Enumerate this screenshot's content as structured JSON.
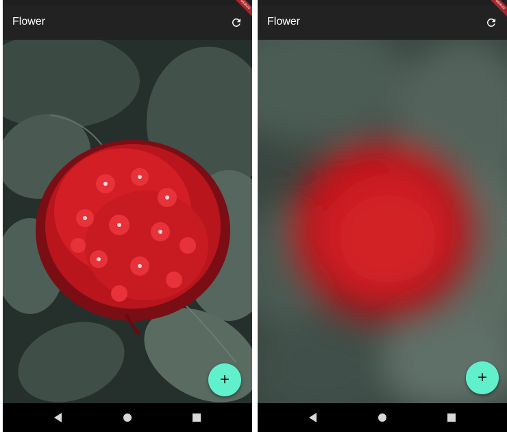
{
  "screens": [
    {
      "variant": "sharp",
      "app_bar": {
        "title": "Flower",
        "action_icon": "refresh-icon"
      },
      "debug_banner": "DEBUG",
      "fab": {
        "label": "+",
        "icon": "plus-icon"
      },
      "nav_bar": {
        "buttons": [
          "back-icon",
          "home-icon",
          "recents-icon"
        ]
      }
    },
    {
      "variant": "blurred",
      "app_bar": {
        "title": "Flower",
        "action_icon": "refresh-icon"
      },
      "debug_banner": "DEBUG",
      "fab": {
        "label": "+",
        "icon": "plus-icon"
      },
      "nav_bar": {
        "buttons": [
          "back-icon",
          "home-icon",
          "recents-icon"
        ]
      }
    }
  ],
  "colors": {
    "app_bar": "#222222",
    "fab": "#61f0cc",
    "flower_red": "#d01d23",
    "leaf_green": "#4f6259",
    "nav_bar": "#000000"
  }
}
